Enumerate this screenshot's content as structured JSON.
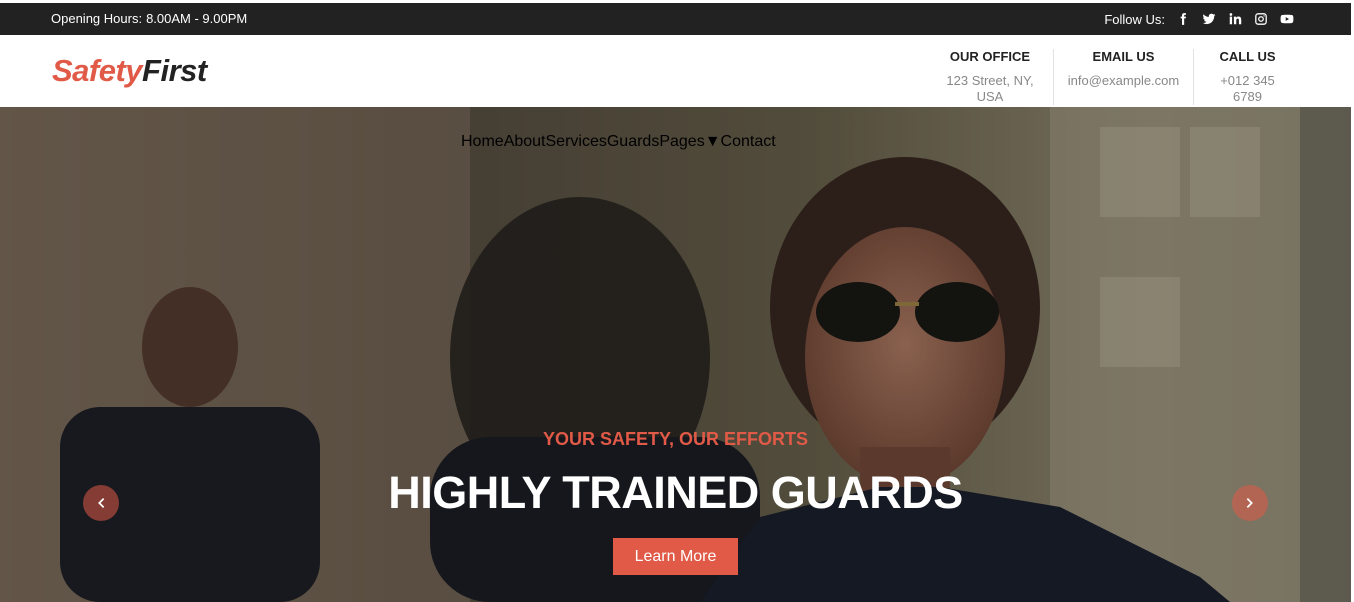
{
  "topbar": {
    "hours_label": "Opening Hours:",
    "hours_value": "8.00AM - 9.00PM",
    "follow_label": "Follow Us:",
    "social_icons": [
      "facebook-icon",
      "twitter-icon",
      "linkedin-icon",
      "instagram-icon",
      "youtube-icon"
    ]
  },
  "header": {
    "logo_part1": "Safety",
    "logo_part2": "First",
    "contacts": [
      {
        "title": "OUR OFFICE",
        "value": "123 Street, NY, USA"
      },
      {
        "title": "EMAIL US",
        "value": "info@example.com"
      },
      {
        "title": "CALL US",
        "value": "+012 345 6789"
      }
    ]
  },
  "nav": {
    "items": [
      "Home",
      "About",
      "Services",
      "Guards",
      "Pages",
      "Contact"
    ],
    "active": "Home"
  },
  "hero": {
    "tagline": "YOUR SAFETY, OUR EFFORTS",
    "headline": "HIGHLY TRAINED GUARDS",
    "cta_label": "Learn More"
  },
  "colors": {
    "accent": "#e05a47",
    "topbar_bg": "#222222",
    "text_dark": "#222222",
    "text_muted": "#888888"
  }
}
